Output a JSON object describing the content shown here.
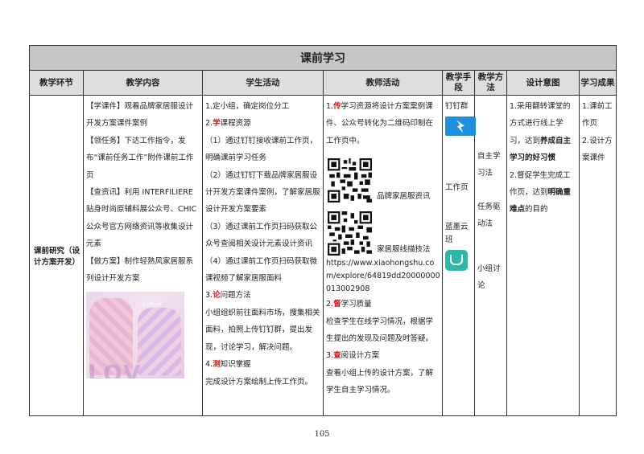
{
  "title": "课前学习",
  "headers": [
    "教学环节",
    "教学内容",
    "学生活动",
    "教师活动",
    "教学手段",
    "教学方法",
    "设计意图",
    "学习成果"
  ],
  "stage": "课前研究（设计方案开发）",
  "content": [
    {
      "tag": "【学课件】",
      "text": "观看品牌家居服设计开发方案课件案例"
    },
    {
      "tag": "【领任务】",
      "text": "下达工作指令，发布“课前任务工作”附件课前工作页"
    },
    {
      "tag": "【查资讯】",
      "text": "利用 INTERFILIERE 贴身时尚原辅料展公众号、CHIC 公众号官方网络资讯等收集设计元素"
    },
    {
      "tag": "【做方案】",
      "text": "制作轻熟风家居服系列设计开发方案"
    }
  ],
  "photo": {
    "label": "Cotton",
    "big_text": "LOV"
  },
  "student": {
    "s1": "1.定小组，确定岗位分工",
    "s2_num": "2.",
    "s2_key": "学",
    "s2_rest": "课程资源",
    "s2_items": [
      "（1）通过钉钉接收课前工作页，明确课前学习任务",
      "（2）通过钉钉下载品牌家居服设计开发方案课件案例，了解家居服设计开发方案要素",
      "（3）通过课前工作页扫码获取公众号查阅相关设计元素设计资讯",
      "（4）通过课前工作页扫码获取微课视频了解家居服面料"
    ],
    "s3_num": "3.",
    "s3_key": "论",
    "s3_rest": "问题方法",
    "s3_text": "小组组织前往面料市场，搜集相关面料，拍照上传钉钉群，提出发现，讨论学习，解决问题。",
    "s4_num": "4.",
    "s4_key": "测",
    "s4_rest": "知识掌握",
    "s4_text": "完成设计方案绘制上传工作页。"
  },
  "teacher": {
    "t1_num": "1.",
    "t1_key": "传",
    "t1_rest": "学习资源将设计方案案例课件、公众号转化为二维码印制在工作页中。",
    "qr1_label": "品牌家居服资讯",
    "qr2_label": "家居服线描技法",
    "url": "https://www.xiaohongshu.com/explore/64819dd20000000013002908",
    "t2_num": "2.",
    "t2_key": "督",
    "t2_rest": "学习质量",
    "t2_text": "检查学生在线学习情况，根据学生提出的发现及问题及时答疑。",
    "t3_num": "3.",
    "t3_key": "查",
    "t3_rest": "阅设计方案",
    "t3_text": "查看小组上传的设计方案，了解学生自主学习情况。"
  },
  "means": {
    "m1": "钉钉群",
    "m2": "工作页",
    "m3": "蓝墨云班"
  },
  "methods": {
    "a": "自主学习法",
    "b": "任务驱动法",
    "c": "小组讨论"
  },
  "intent": {
    "i1_pre": "1.采用翻转课堂的方式进行线上学习，达到",
    "i1_bold": "养成自主学习的好习惯",
    "i2_pre": "2.督促学生完成工作页，达到",
    "i2_bold": "明确重难点",
    "i2_post": "的目的"
  },
  "outcome": {
    "o1": "1.课前工作页",
    "o2": "2.设计方案课件"
  },
  "page_number": "105"
}
